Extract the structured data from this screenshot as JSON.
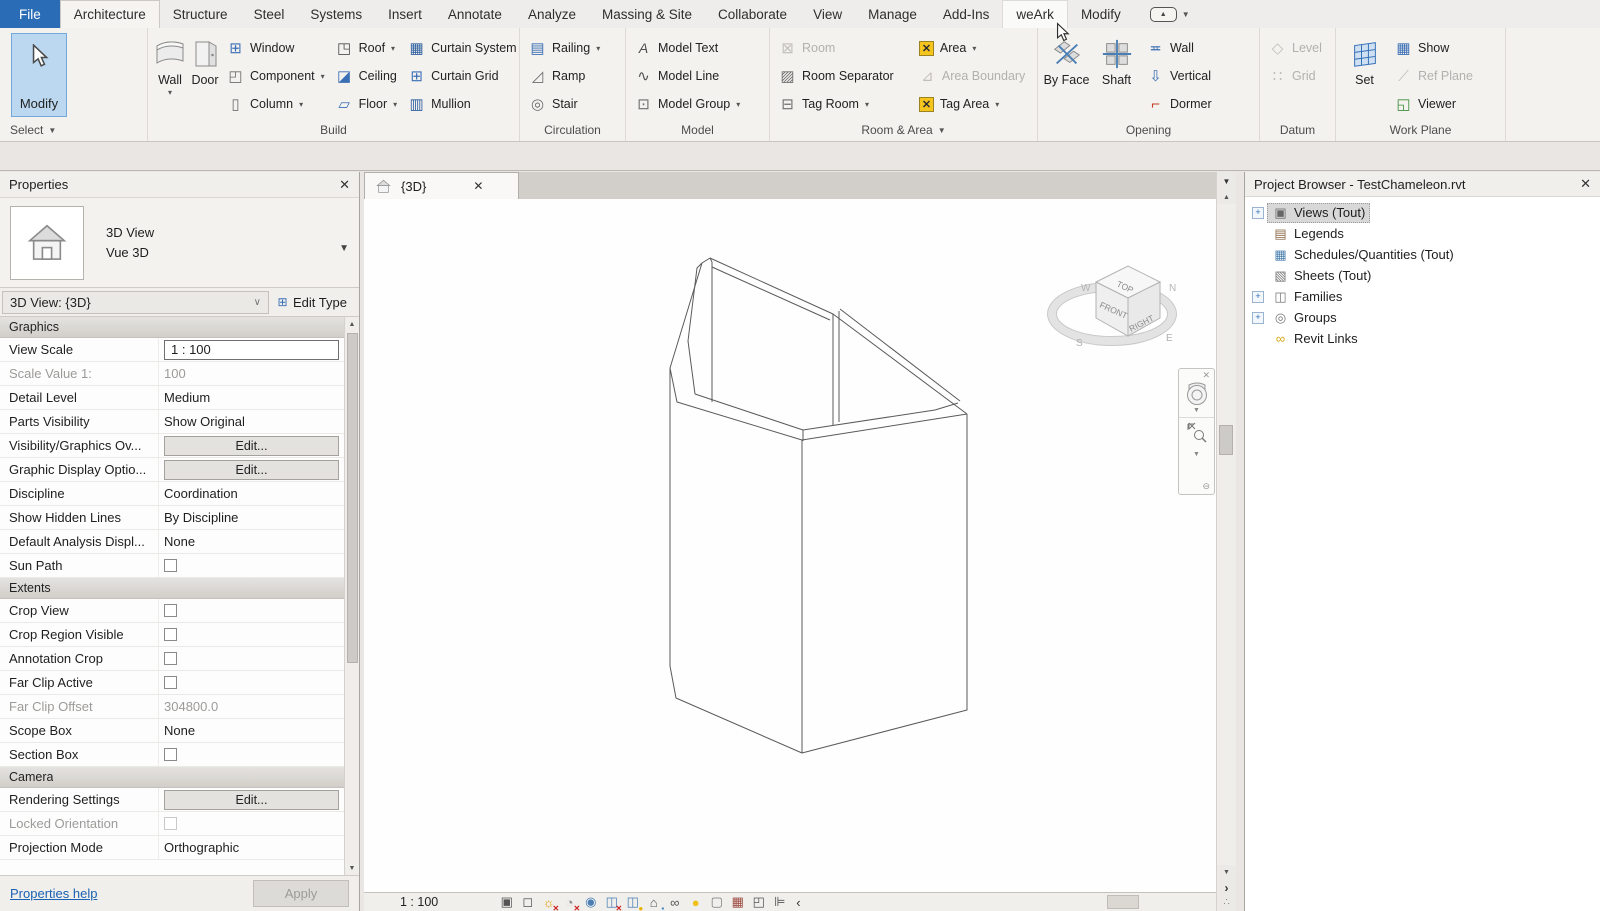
{
  "menubar": {
    "tabs": [
      {
        "label": "File",
        "state": "file"
      },
      {
        "label": "Architecture",
        "state": "active"
      },
      {
        "label": "Structure"
      },
      {
        "label": "Steel"
      },
      {
        "label": "Systems"
      },
      {
        "label": "Insert"
      },
      {
        "label": "Annotate"
      },
      {
        "label": "Analyze"
      },
      {
        "label": "Massing & Site"
      },
      {
        "label": "Collaborate"
      },
      {
        "label": "View"
      },
      {
        "label": "Manage"
      },
      {
        "label": "Add-Ins"
      },
      {
        "label": "weArk",
        "state": "hover"
      },
      {
        "label": "Modify"
      }
    ]
  },
  "ribbon": {
    "select": {
      "modify": "Modify",
      "panel_label": "Select"
    },
    "build": {
      "wall": "Wall",
      "door": "Door",
      "window": "Window",
      "component": "Component",
      "column": "Column",
      "roof": "Roof",
      "ceiling": "Ceiling",
      "floor": "Floor",
      "curtain_system": "Curtain System",
      "curtain_grid": "Curtain Grid",
      "mullion": "Mullion",
      "panel_label": "Build"
    },
    "circulation": {
      "railing": "Railing",
      "ramp": "Ramp",
      "stair": "Stair",
      "panel_label": "Circulation"
    },
    "model": {
      "model_text": "Model Text",
      "model_line": "Model Line",
      "model_group": "Model Group",
      "panel_label": "Model"
    },
    "room_area": {
      "room": "Room",
      "room_separator": "Room Separator",
      "tag_room": "Tag Room",
      "area": "Area",
      "area_boundary": "Area Boundary",
      "tag_area": "Tag Area",
      "panel_label": "Room & Area"
    },
    "opening": {
      "by_face": "By Face",
      "shaft": "Shaft",
      "wall": "Wall",
      "vertical": "Vertical",
      "dormer": "Dormer",
      "panel_label": "Opening"
    },
    "datum": {
      "level": "Level",
      "grid": "Grid",
      "panel_label": "Datum"
    },
    "work_plane": {
      "set": "Set",
      "show": "Show",
      "ref_plane": "Ref Plane",
      "viewer": "Viewer",
      "panel_label": "Work Plane"
    }
  },
  "properties": {
    "title": "Properties",
    "preview": {
      "type": "3D View",
      "name": "Vue 3D"
    },
    "type_selector": "3D View: {3D}",
    "edit_type": "Edit Type",
    "rows": [
      {
        "kind": "section",
        "label": "Graphics"
      },
      {
        "kind": "input",
        "label": "View Scale",
        "value": "1 : 100"
      },
      {
        "kind": "textgray",
        "label": "Scale Value    1:",
        "value": "100"
      },
      {
        "kind": "text",
        "label": "Detail Level",
        "value": "Medium"
      },
      {
        "kind": "text",
        "label": "Parts Visibility",
        "value": "Show Original"
      },
      {
        "kind": "button",
        "label": "Visibility/Graphics Ov...",
        "value": "Edit..."
      },
      {
        "kind": "button",
        "label": "Graphic Display Optio...",
        "value": "Edit..."
      },
      {
        "kind": "text",
        "label": "Discipline",
        "value": "Coordination"
      },
      {
        "kind": "text",
        "label": "Show Hidden Lines",
        "value": "By Discipline"
      },
      {
        "kind": "text",
        "label": "Default Analysis Displ...",
        "value": "None"
      },
      {
        "kind": "check",
        "label": "Sun Path"
      },
      {
        "kind": "section",
        "label": "Extents"
      },
      {
        "kind": "check",
        "label": "Crop View"
      },
      {
        "kind": "check",
        "label": "Crop Region Visible"
      },
      {
        "kind": "check",
        "label": "Annotation Crop"
      },
      {
        "kind": "check",
        "label": "Far Clip Active"
      },
      {
        "kind": "textgray",
        "label": "Far Clip Offset",
        "value": "304800.0"
      },
      {
        "kind": "text",
        "label": "Scope Box",
        "value": "None"
      },
      {
        "kind": "check",
        "label": "Section Box"
      },
      {
        "kind": "section",
        "label": "Camera"
      },
      {
        "kind": "button",
        "label": "Rendering Settings",
        "value": "Edit..."
      },
      {
        "kind": "checkgray",
        "label": "Locked Orientation"
      },
      {
        "kind": "text",
        "label": "Projection Mode",
        "value": "Orthographic"
      }
    ],
    "help_link": "Properties help",
    "apply": "Apply"
  },
  "viewtab": {
    "label": "{3D}"
  },
  "viewcube": {
    "top": "TOP",
    "front": "FRONT",
    "right": "RIGHT",
    "west": "W",
    "north": "N",
    "south": "S",
    "east": "E"
  },
  "statusbar": {
    "scale": "1 : 100",
    "icons": [
      {
        "name": "detail-level-icon",
        "glyph": "▣",
        "color": "#555555"
      },
      {
        "name": "visual-style-icon",
        "glyph": "◻",
        "color": "#555555"
      },
      {
        "name": "sun-path-icon",
        "glyph": "☼",
        "color": "#e09c00",
        "overlay": "✕",
        "overlay_color": "#cc1f1f"
      },
      {
        "name": "shadows-icon",
        "glyph": "◔",
        "color": "#8a8a8a",
        "overlay": "✕",
        "overlay_color": "#cc1f1f"
      },
      {
        "name": "rendering-dialog-icon",
        "glyph": "◉",
        "color": "#4a7fb5"
      },
      {
        "name": "crop-view-icon",
        "glyph": "◫",
        "color": "#4a7fb5",
        "overlay": "✕",
        "overlay_color": "#cc1f1f"
      },
      {
        "name": "crop-region-icon",
        "glyph": "◫",
        "color": "#4a7fb5",
        "overlay": "●",
        "overlay_color": "#e8b400"
      },
      {
        "name": "view-lock-icon",
        "glyph": "⌂",
        "color": "#555555",
        "overlay": "▪",
        "overlay_color": "#3f7fbf"
      },
      {
        "name": "hide-isolate-icon",
        "glyph": "∞",
        "color": "#555555"
      },
      {
        "name": "reveal-hidden-icon",
        "glyph": "●",
        "color": "#f0c11a"
      },
      {
        "name": "temp-view-properties-icon",
        "glyph": "▢",
        "color": "#7a7a7a"
      },
      {
        "name": "analytical-model-icon",
        "glyph": "▦",
        "color": "#9c4a3f"
      },
      {
        "name": "displacement-sets-icon",
        "glyph": "◰",
        "color": "#555555"
      },
      {
        "name": "reveal-constraints-icon",
        "glyph": "⊫",
        "color": "#555555"
      }
    ],
    "collapse_icon": "‹"
  },
  "browser": {
    "title": "Project Browser - TestChameleon.rvt",
    "items": [
      {
        "label": "Views (Tout)",
        "expand": true,
        "selected": true,
        "icon": "views-icon",
        "glyph": "▣",
        "color": "#666666"
      },
      {
        "label": "Legends",
        "icon": "legends-icon",
        "glyph": "▤",
        "color": "#8a6a4a"
      },
      {
        "label": "Schedules/Quantities (Tout)",
        "icon": "schedules-icon",
        "glyph": "▦",
        "color": "#4a7fae"
      },
      {
        "label": "Sheets (Tout)",
        "icon": "sheets-icon",
        "glyph": "▧",
        "color": "#777777"
      },
      {
        "label": "Families",
        "expand": true,
        "icon": "families-icon",
        "glyph": "◫",
        "color": "#777777"
      },
      {
        "label": "Groups",
        "expand": true,
        "icon": "groups-icon",
        "glyph": "◎",
        "color": "#777777"
      },
      {
        "label": "Revit Links",
        "icon": "revit-links-icon",
        "glyph": "∞",
        "color": "#d9a514"
      }
    ]
  }
}
